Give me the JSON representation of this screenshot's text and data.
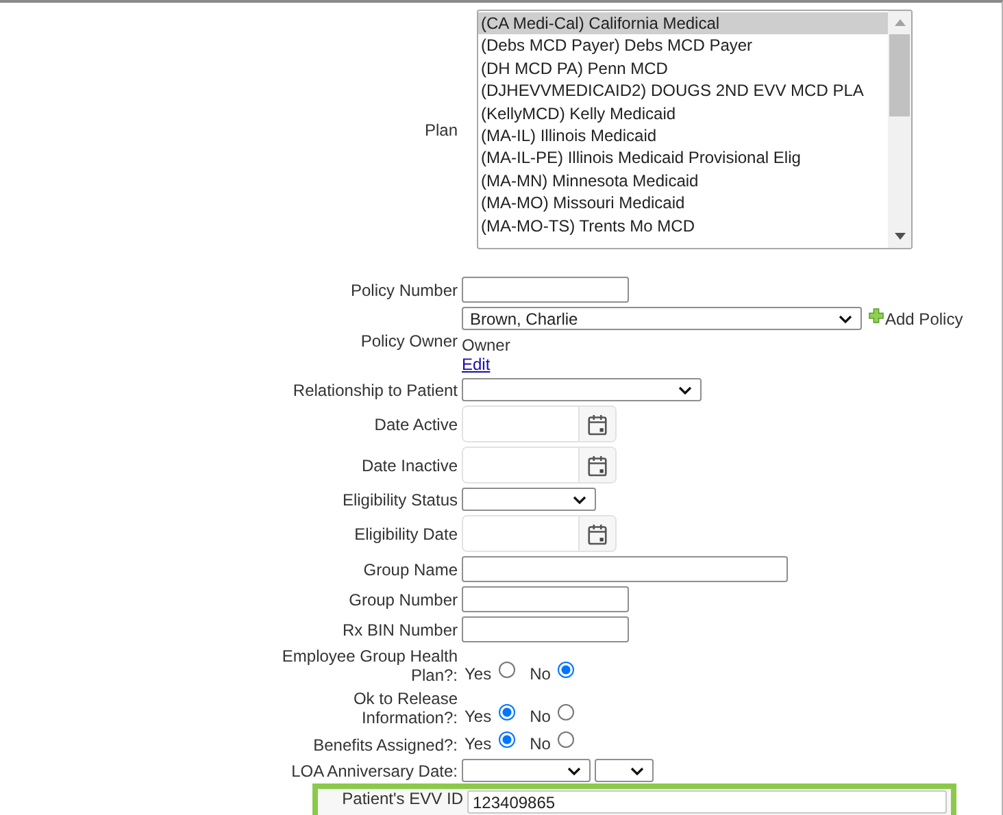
{
  "plan": {
    "label": "Plan",
    "options": [
      {
        "text": "(CA Medi-Cal) California Medical",
        "selected": true
      },
      {
        "text": "(Debs MCD Payer) Debs MCD Payer",
        "selected": false
      },
      {
        "text": "(DH MCD PA) Penn MCD",
        "selected": false
      },
      {
        "text": "(DJHEVVMEDICAID2) DOUGS 2ND EVV MCD PLA",
        "selected": false
      },
      {
        "text": "(KellyMCD) Kelly Medicaid",
        "selected": false
      },
      {
        "text": "(MA-IL) Illinois Medicaid",
        "selected": false
      },
      {
        "text": "(MA-IL-PE) Illinois Medicaid Provisional Elig",
        "selected": false
      },
      {
        "text": "(MA-MN) Minnesota Medicaid",
        "selected": false
      },
      {
        "text": "(MA-MO) Missouri Medicaid",
        "selected": false
      },
      {
        "text": "(MA-MO-TS) Trents Mo MCD",
        "selected": false
      }
    ]
  },
  "rows": [
    {
      "kind": "text",
      "label": "Policy Number"
    },
    {
      "kind": "owner",
      "label": "Policy Owner",
      "value": "Brown, Charlie",
      "add": "Add Policy",
      "note": "Owner",
      "link": "Edit"
    },
    {
      "kind": "select",
      "label": "Relationship to Patient"
    },
    {
      "kind": "date",
      "label": "Date Active"
    },
    {
      "kind": "date",
      "label": "Date Inactive"
    },
    {
      "kind": "short_select",
      "label": "Eligibility Status"
    },
    {
      "kind": "date",
      "label": "Eligibility Date"
    },
    {
      "kind": "long_text",
      "label": "Group Name"
    },
    {
      "kind": "text",
      "label": "Group Number"
    },
    {
      "kind": "text",
      "label": "Rx BIN Number"
    },
    {
      "kind": "radio",
      "label": "Employee Group Health Plan?:",
      "options": [
        {
          "label": "Yes",
          "selected": false
        },
        {
          "label": "No",
          "selected": true
        }
      ]
    },
    {
      "kind": "radio",
      "label": "Ok to Release Information?:",
      "options": [
        {
          "label": "Yes",
          "selected": true
        },
        {
          "label": "No",
          "selected": false
        }
      ]
    },
    {
      "kind": "radio",
      "label": "Benefits Assigned?:",
      "options": [
        {
          "label": "Yes",
          "selected": true
        },
        {
          "label": "No",
          "selected": false
        }
      ]
    },
    {
      "kind": "loa",
      "label": "LOA Anniversary Date:"
    }
  ],
  "evv": {
    "label": "Patient's EVV ID",
    "value": "123409865",
    "highlighted": true
  }
}
